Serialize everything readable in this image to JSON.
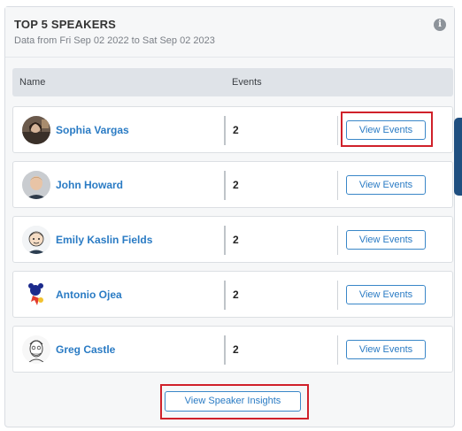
{
  "card": {
    "title": "TOP 5 SPEAKERS",
    "subtitle": "Data from Fri Sep 02 2022 to Sat Sep 02 2023",
    "info_icon": "info-icon",
    "info_glyph": "i"
  },
  "table": {
    "columns": [
      "Name",
      "Events"
    ],
    "rows": [
      {
        "name": "Sophia Vargas",
        "events": "2",
        "button": "View Events",
        "avatar": "photo-avatar"
      },
      {
        "name": "John Howard",
        "events": "2",
        "button": "View Events",
        "avatar": "photo-avatar"
      },
      {
        "name": "Emily Kaslin Fields",
        "events": "2",
        "button": "View Events",
        "avatar": "cartoon-avatar"
      },
      {
        "name": "Antonio Ojea",
        "events": "2",
        "button": "View Events",
        "avatar": "logo-avatar"
      },
      {
        "name": "Greg Castle",
        "events": "2",
        "button": "View Events",
        "avatar": "sketch-avatar"
      }
    ]
  },
  "footer": {
    "insights_button": "View Speaker Insights"
  },
  "colors": {
    "link": "#2a7bc4",
    "highlight": "#d0212a",
    "scroll_thumb": "#1f4f80"
  }
}
